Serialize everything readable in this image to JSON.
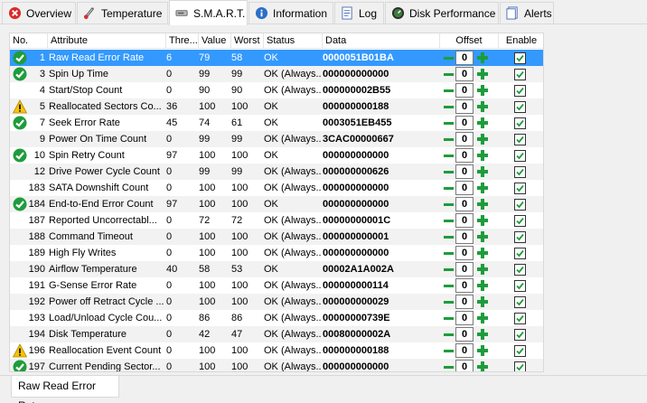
{
  "tabs": [
    {
      "label": "Overview",
      "icon": "error-icon"
    },
    {
      "label": "Temperature",
      "icon": "thermometer-icon"
    },
    {
      "label": "S.M.A.R.T.",
      "icon": "smart-icon",
      "active": true
    },
    {
      "label": "Information",
      "icon": "info-icon"
    },
    {
      "label": "Log",
      "icon": "log-icon"
    },
    {
      "label": "Disk Performance",
      "icon": "performance-icon"
    },
    {
      "label": "Alerts",
      "icon": "alerts-icon"
    }
  ],
  "columns": [
    "No.",
    "Attribute",
    "Thre...",
    "Value",
    "Worst",
    "Status",
    "Data",
    "Offset",
    "Enable"
  ],
  "rows": [
    {
      "icon": "ok",
      "no": "1",
      "attr": "Raw Read Error Rate",
      "thr": "6",
      "val": "79",
      "worst": "58",
      "status": "OK",
      "data": "0000051B01BA",
      "offset": "0",
      "selected": true
    },
    {
      "icon": "ok",
      "no": "3",
      "attr": "Spin Up Time",
      "thr": "0",
      "val": "99",
      "worst": "99",
      "status": "OK (Always...",
      "data": "000000000000",
      "offset": "0"
    },
    {
      "icon": "",
      "no": "4",
      "attr": "Start/Stop Count",
      "thr": "0",
      "val": "90",
      "worst": "90",
      "status": "OK (Always...",
      "data": "000000002B55",
      "offset": "0"
    },
    {
      "icon": "warn",
      "no": "5",
      "attr": "Reallocated Sectors Co...",
      "thr": "36",
      "val": "100",
      "worst": "100",
      "status": "OK",
      "data": "000000000188",
      "offset": "0"
    },
    {
      "icon": "ok",
      "no": "7",
      "attr": "Seek Error Rate",
      "thr": "45",
      "val": "74",
      "worst": "61",
      "status": "OK",
      "data": "0003051EB455",
      "offset": "0"
    },
    {
      "icon": "",
      "no": "9",
      "attr": "Power On Time Count",
      "thr": "0",
      "val": "99",
      "worst": "99",
      "status": "OK (Always...",
      "data": "3CAC00000667",
      "offset": "0"
    },
    {
      "icon": "ok",
      "no": "10",
      "attr": "Spin Retry Count",
      "thr": "97",
      "val": "100",
      "worst": "100",
      "status": "OK",
      "data": "000000000000",
      "offset": "0"
    },
    {
      "icon": "",
      "no": "12",
      "attr": "Drive Power Cycle Count",
      "thr": "0",
      "val": "99",
      "worst": "99",
      "status": "OK (Always...",
      "data": "000000000626",
      "offset": "0"
    },
    {
      "icon": "",
      "no": "183",
      "attr": "SATA Downshift Count",
      "thr": "0",
      "val": "100",
      "worst": "100",
      "status": "OK (Always...",
      "data": "000000000000",
      "offset": "0"
    },
    {
      "icon": "ok",
      "no": "184",
      "attr": "End-to-End Error Count",
      "thr": "97",
      "val": "100",
      "worst": "100",
      "status": "OK",
      "data": "000000000000",
      "offset": "0"
    },
    {
      "icon": "",
      "no": "187",
      "attr": "Reported Uncorrectabl...",
      "thr": "0",
      "val": "72",
      "worst": "72",
      "status": "OK (Always...",
      "data": "00000000001C",
      "offset": "0"
    },
    {
      "icon": "",
      "no": "188",
      "attr": "Command Timeout",
      "thr": "0",
      "val": "100",
      "worst": "100",
      "status": "OK (Always...",
      "data": "000000000001",
      "offset": "0"
    },
    {
      "icon": "",
      "no": "189",
      "attr": "High Fly Writes",
      "thr": "0",
      "val": "100",
      "worst": "100",
      "status": "OK (Always...",
      "data": "000000000000",
      "offset": "0"
    },
    {
      "icon": "",
      "no": "190",
      "attr": "Airflow Temperature",
      "thr": "40",
      "val": "58",
      "worst": "53",
      "status": "OK",
      "data": "00002A1A002A",
      "offset": "0"
    },
    {
      "icon": "",
      "no": "191",
      "attr": "G-Sense Error Rate",
      "thr": "0",
      "val": "100",
      "worst": "100",
      "status": "OK (Always...",
      "data": "000000000114",
      "offset": "0"
    },
    {
      "icon": "",
      "no": "192",
      "attr": "Power off Retract Cycle ...",
      "thr": "0",
      "val": "100",
      "worst": "100",
      "status": "OK (Always...",
      "data": "000000000029",
      "offset": "0"
    },
    {
      "icon": "",
      "no": "193",
      "attr": "Load/Unload Cycle Cou...",
      "thr": "0",
      "val": "86",
      "worst": "86",
      "status": "OK (Always...",
      "data": "00000000739E",
      "offset": "0"
    },
    {
      "icon": "",
      "no": "194",
      "attr": "Disk Temperature",
      "thr": "0",
      "val": "42",
      "worst": "47",
      "status": "OK (Always...",
      "data": "00080000002A",
      "offset": "0"
    },
    {
      "icon": "warn",
      "no": "196",
      "attr": "Reallocation Event Count",
      "thr": "0",
      "val": "100",
      "worst": "100",
      "status": "OK (Always...",
      "data": "000000000188",
      "offset": "0"
    },
    {
      "icon": "ok",
      "no": "197",
      "attr": "Current Pending Sector...",
      "thr": "0",
      "val": "100",
      "worst": "100",
      "status": "OK (Always...",
      "data": "000000000000",
      "offset": "0"
    }
  ],
  "bottom_tab": "Raw Read Error Rate",
  "colors": {
    "ok": "#1e9c3c",
    "warn": "#f5c400",
    "selection": "#3399ff"
  }
}
